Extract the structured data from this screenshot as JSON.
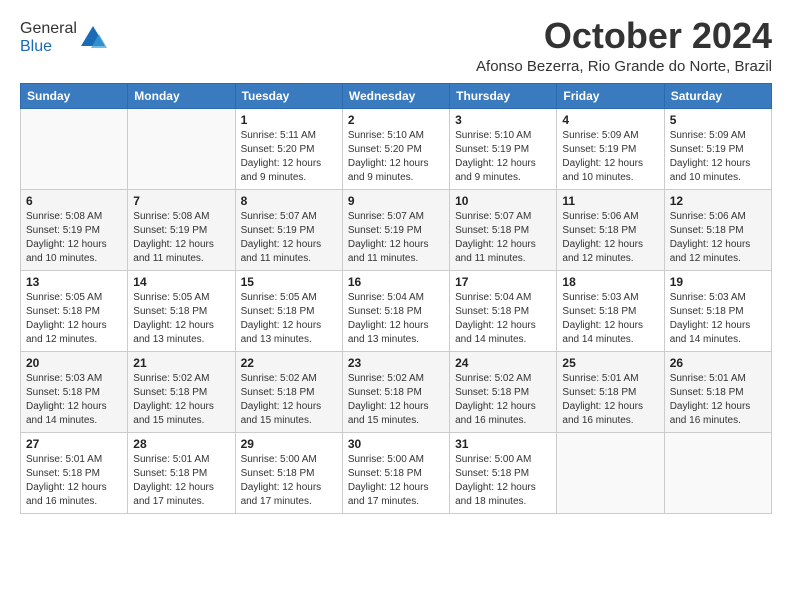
{
  "header": {
    "logo_general": "General",
    "logo_blue": "Blue",
    "month_title": "October 2024",
    "location": "Afonso Bezerra, Rio Grande do Norte, Brazil"
  },
  "calendar": {
    "days_of_week": [
      "Sunday",
      "Monday",
      "Tuesday",
      "Wednesday",
      "Thursday",
      "Friday",
      "Saturday"
    ],
    "weeks": [
      [
        {
          "day": "",
          "info": ""
        },
        {
          "day": "",
          "info": ""
        },
        {
          "day": "1",
          "info": "Sunrise: 5:11 AM\nSunset: 5:20 PM\nDaylight: 12 hours and 9 minutes."
        },
        {
          "day": "2",
          "info": "Sunrise: 5:10 AM\nSunset: 5:20 PM\nDaylight: 12 hours and 9 minutes."
        },
        {
          "day": "3",
          "info": "Sunrise: 5:10 AM\nSunset: 5:19 PM\nDaylight: 12 hours and 9 minutes."
        },
        {
          "day": "4",
          "info": "Sunrise: 5:09 AM\nSunset: 5:19 PM\nDaylight: 12 hours and 10 minutes."
        },
        {
          "day": "5",
          "info": "Sunrise: 5:09 AM\nSunset: 5:19 PM\nDaylight: 12 hours and 10 minutes."
        }
      ],
      [
        {
          "day": "6",
          "info": "Sunrise: 5:08 AM\nSunset: 5:19 PM\nDaylight: 12 hours and 10 minutes."
        },
        {
          "day": "7",
          "info": "Sunrise: 5:08 AM\nSunset: 5:19 PM\nDaylight: 12 hours and 11 minutes."
        },
        {
          "day": "8",
          "info": "Sunrise: 5:07 AM\nSunset: 5:19 PM\nDaylight: 12 hours and 11 minutes."
        },
        {
          "day": "9",
          "info": "Sunrise: 5:07 AM\nSunset: 5:19 PM\nDaylight: 12 hours and 11 minutes."
        },
        {
          "day": "10",
          "info": "Sunrise: 5:07 AM\nSunset: 5:18 PM\nDaylight: 12 hours and 11 minutes."
        },
        {
          "day": "11",
          "info": "Sunrise: 5:06 AM\nSunset: 5:18 PM\nDaylight: 12 hours and 12 minutes."
        },
        {
          "day": "12",
          "info": "Sunrise: 5:06 AM\nSunset: 5:18 PM\nDaylight: 12 hours and 12 minutes."
        }
      ],
      [
        {
          "day": "13",
          "info": "Sunrise: 5:05 AM\nSunset: 5:18 PM\nDaylight: 12 hours and 12 minutes."
        },
        {
          "day": "14",
          "info": "Sunrise: 5:05 AM\nSunset: 5:18 PM\nDaylight: 12 hours and 13 minutes."
        },
        {
          "day": "15",
          "info": "Sunrise: 5:05 AM\nSunset: 5:18 PM\nDaylight: 12 hours and 13 minutes."
        },
        {
          "day": "16",
          "info": "Sunrise: 5:04 AM\nSunset: 5:18 PM\nDaylight: 12 hours and 13 minutes."
        },
        {
          "day": "17",
          "info": "Sunrise: 5:04 AM\nSunset: 5:18 PM\nDaylight: 12 hours and 14 minutes."
        },
        {
          "day": "18",
          "info": "Sunrise: 5:03 AM\nSunset: 5:18 PM\nDaylight: 12 hours and 14 minutes."
        },
        {
          "day": "19",
          "info": "Sunrise: 5:03 AM\nSunset: 5:18 PM\nDaylight: 12 hours and 14 minutes."
        }
      ],
      [
        {
          "day": "20",
          "info": "Sunrise: 5:03 AM\nSunset: 5:18 PM\nDaylight: 12 hours and 14 minutes."
        },
        {
          "day": "21",
          "info": "Sunrise: 5:02 AM\nSunset: 5:18 PM\nDaylight: 12 hours and 15 minutes."
        },
        {
          "day": "22",
          "info": "Sunrise: 5:02 AM\nSunset: 5:18 PM\nDaylight: 12 hours and 15 minutes."
        },
        {
          "day": "23",
          "info": "Sunrise: 5:02 AM\nSunset: 5:18 PM\nDaylight: 12 hours and 15 minutes."
        },
        {
          "day": "24",
          "info": "Sunrise: 5:02 AM\nSunset: 5:18 PM\nDaylight: 12 hours and 16 minutes."
        },
        {
          "day": "25",
          "info": "Sunrise: 5:01 AM\nSunset: 5:18 PM\nDaylight: 12 hours and 16 minutes."
        },
        {
          "day": "26",
          "info": "Sunrise: 5:01 AM\nSunset: 5:18 PM\nDaylight: 12 hours and 16 minutes."
        }
      ],
      [
        {
          "day": "27",
          "info": "Sunrise: 5:01 AM\nSunset: 5:18 PM\nDaylight: 12 hours and 16 minutes."
        },
        {
          "day": "28",
          "info": "Sunrise: 5:01 AM\nSunset: 5:18 PM\nDaylight: 12 hours and 17 minutes."
        },
        {
          "day": "29",
          "info": "Sunrise: 5:00 AM\nSunset: 5:18 PM\nDaylight: 12 hours and 17 minutes."
        },
        {
          "day": "30",
          "info": "Sunrise: 5:00 AM\nSunset: 5:18 PM\nDaylight: 12 hours and 17 minutes."
        },
        {
          "day": "31",
          "info": "Sunrise: 5:00 AM\nSunset: 5:18 PM\nDaylight: 12 hours and 18 minutes."
        },
        {
          "day": "",
          "info": ""
        },
        {
          "day": "",
          "info": ""
        }
      ]
    ]
  }
}
